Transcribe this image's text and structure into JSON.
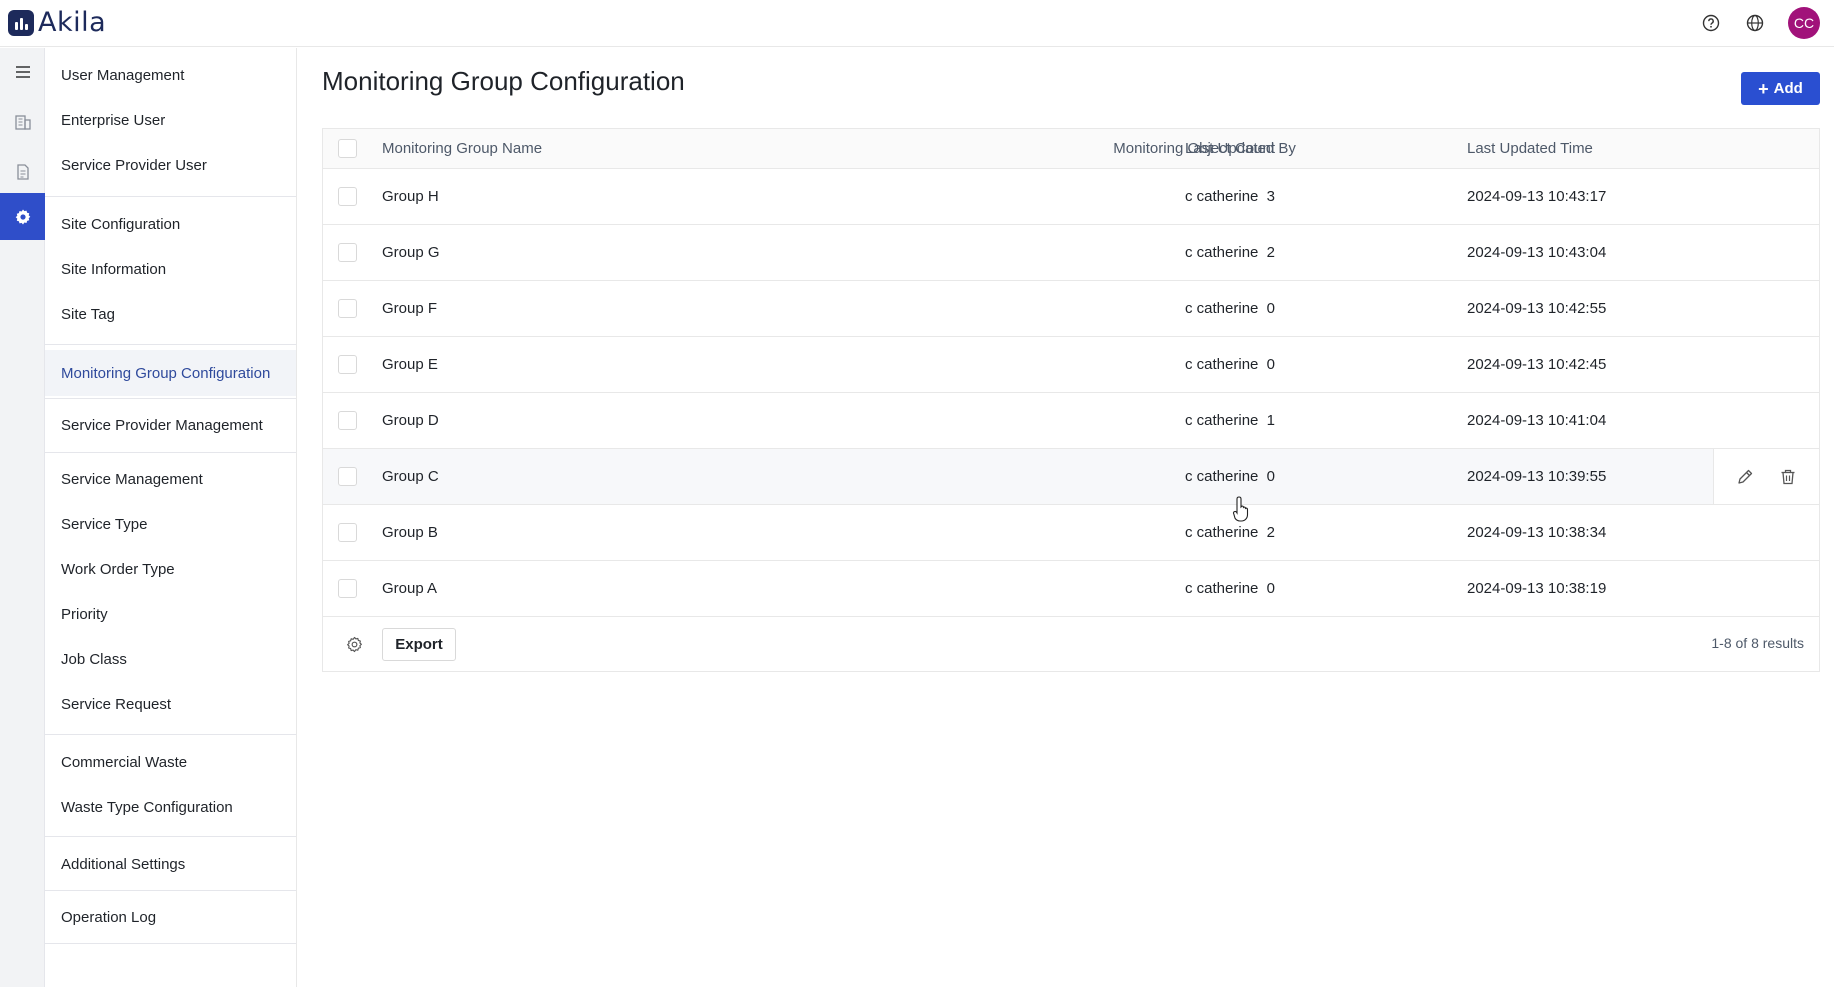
{
  "app": {
    "name": "Akila"
  },
  "header": {
    "avatar_initials": "CC",
    "icons": [
      "help-icon",
      "globe-icon"
    ],
    "avatar_color": "#a1127a"
  },
  "rail": {
    "items": [
      "menu-icon",
      "building-icon",
      "report-icon",
      "settings-icon"
    ],
    "active_color": "#2f4ec9"
  },
  "sidebar": {
    "items": [
      {
        "label": "User Management"
      },
      {
        "label": "Enterprise User"
      },
      {
        "label": "Service Provider User"
      },
      {
        "label": "Site Configuration"
      },
      {
        "label": "Site Information"
      },
      {
        "label": "Site Tag"
      },
      {
        "label": "Monitoring Group Configuration",
        "active": true
      },
      {
        "label": "Service Provider Management"
      },
      {
        "label": "Service Management"
      },
      {
        "label": "Service Type"
      },
      {
        "label": "Work Order Type"
      },
      {
        "label": "Priority"
      },
      {
        "label": "Job Class"
      },
      {
        "label": "Service Request"
      },
      {
        "label": "Commercial Waste"
      },
      {
        "label": "Waste Type Configuration"
      },
      {
        "label": "Additional Settings"
      },
      {
        "label": "Operation Log"
      }
    ]
  },
  "main": {
    "title": "Monitoring Group Configuration",
    "add_label": "Add",
    "accent_color": "#2a4fd1",
    "table": {
      "columns": {
        "name": "Monitoring Group Name",
        "count": "Monitoring Object Count",
        "by": "Last Updated By",
        "time": "Last Updated Time"
      },
      "rows": [
        {
          "name": "Group H",
          "count": "3",
          "by": "c catherine",
          "time": "2024-09-13 10:43:17"
        },
        {
          "name": "Group G",
          "count": "2",
          "by": "c catherine",
          "time": "2024-09-13 10:43:04"
        },
        {
          "name": "Group F",
          "count": "0",
          "by": "c catherine",
          "time": "2024-09-13 10:42:55"
        },
        {
          "name": "Group E",
          "count": "0",
          "by": "c catherine",
          "time": "2024-09-13 10:42:45"
        },
        {
          "name": "Group D",
          "count": "1",
          "by": "c catherine",
          "time": "2024-09-13 10:41:04"
        },
        {
          "name": "Group C",
          "count": "0",
          "by": "c catherine",
          "time": "2024-09-13 10:39:55"
        },
        {
          "name": "Group B",
          "count": "2",
          "by": "c catherine",
          "time": "2024-09-13 10:38:34"
        },
        {
          "name": "Group A",
          "count": "0",
          "by": "c catherine",
          "time": "2024-09-13 10:38:19"
        }
      ],
      "hovered_row": "Group C",
      "row_action_icons": [
        "edit-icon",
        "trash-icon"
      ]
    },
    "footer": {
      "export_label": "Export",
      "results_text": "1-8 of 8 results"
    }
  }
}
